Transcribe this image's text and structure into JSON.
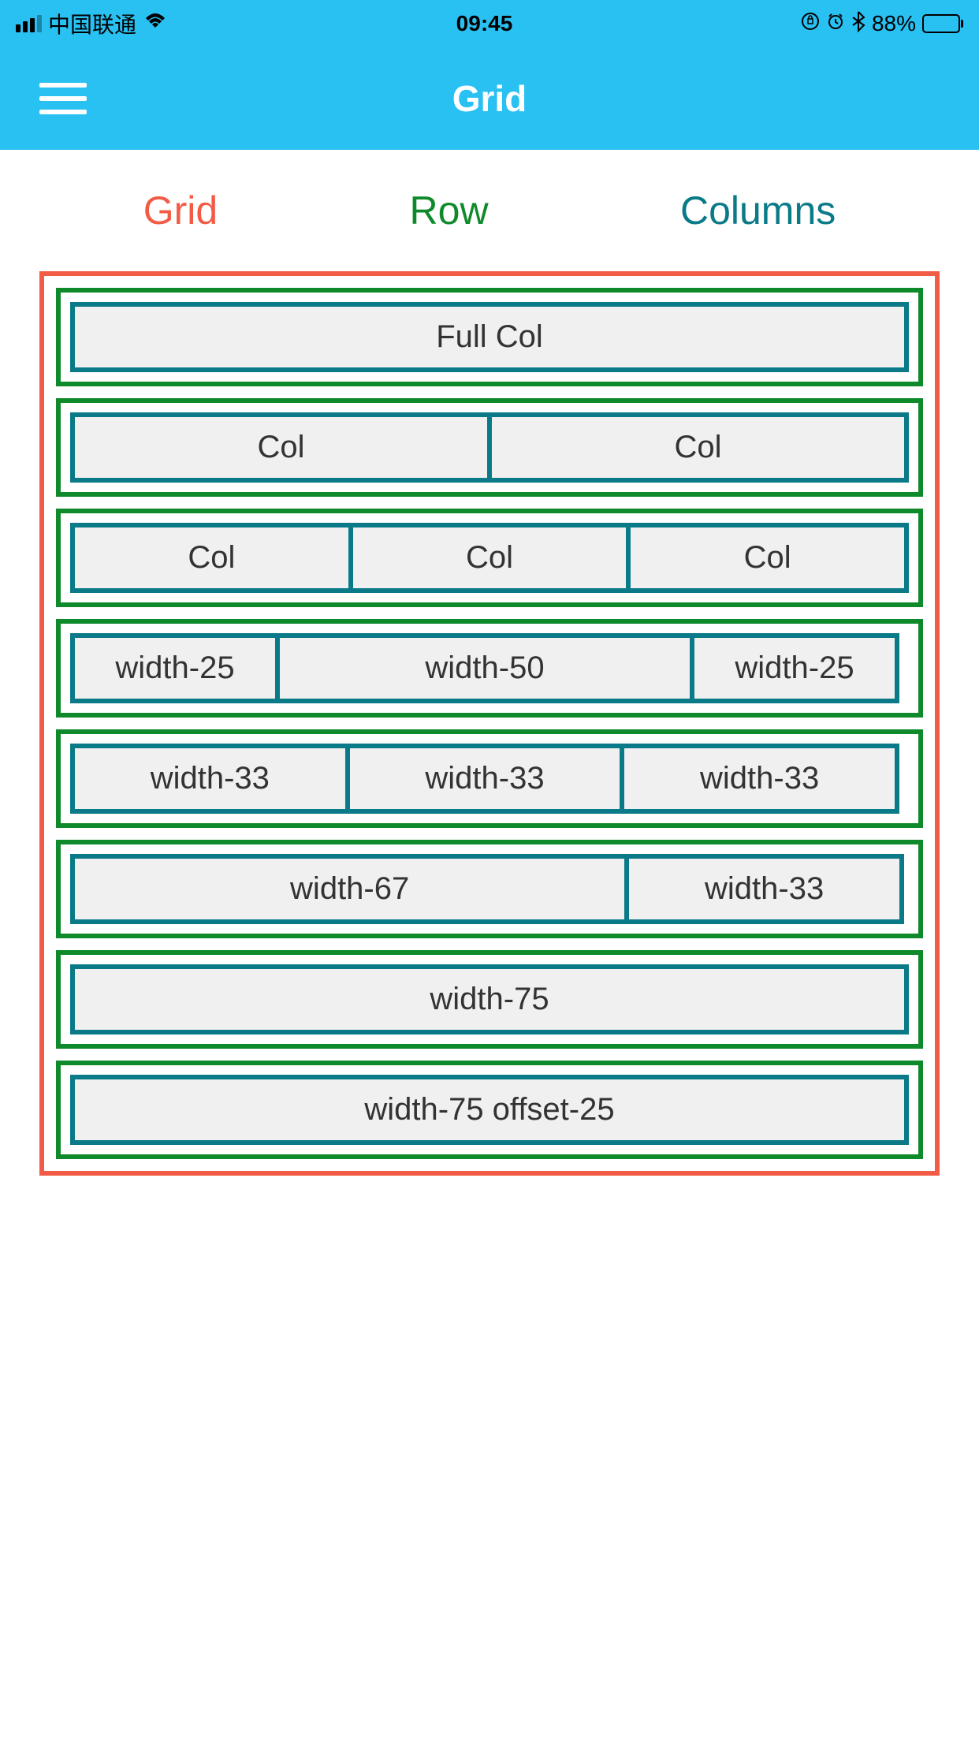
{
  "statusbar": {
    "carrier": "中国联通",
    "time": "09:45",
    "battery_percent": "88%"
  },
  "header": {
    "title": "Grid"
  },
  "legend": {
    "grid": "Grid",
    "row": "Row",
    "columns": "Columns"
  },
  "rows": [
    {
      "cols": [
        {
          "label": "Full Col"
        }
      ]
    },
    {
      "cols": [
        {
          "label": "Col"
        },
        {
          "label": "Col"
        }
      ]
    },
    {
      "cols": [
        {
          "label": "Col"
        },
        {
          "label": "Col"
        },
        {
          "label": "Col"
        }
      ]
    },
    {
      "cols": [
        {
          "label": "width-25"
        },
        {
          "label": "width-50"
        },
        {
          "label": "width-25"
        }
      ]
    },
    {
      "cols": [
        {
          "label": "width-33"
        },
        {
          "label": "width-33"
        },
        {
          "label": "width-33"
        }
      ]
    },
    {
      "cols": [
        {
          "label": "width-67"
        },
        {
          "label": "width-33"
        }
      ]
    },
    {
      "cols": [
        {
          "label": "width-75"
        }
      ]
    },
    {
      "cols": [
        {
          "label": "width-75 offset-25"
        }
      ]
    }
  ]
}
